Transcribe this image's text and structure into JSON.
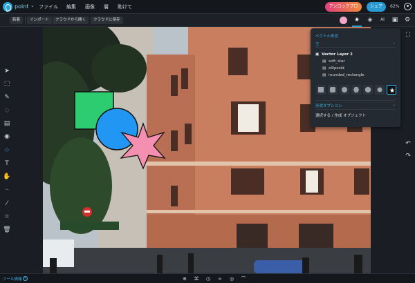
{
  "app": {
    "name": "point"
  },
  "menu": [
    "ファイル",
    "編集",
    "画像",
    "層",
    "助けて"
  ],
  "header": {
    "pro_label": "アンロックプロ",
    "share_label": "シェア",
    "zoom": "62%"
  },
  "toolbar": {
    "new_label": "新着",
    "import_label": "インポート",
    "open_cloud_label": "クラウドから開く",
    "save_cloud_label": "クラウドに保存",
    "fill_color": "#f2a6c8"
  },
  "panel": {
    "section_title": "ベクトル形状",
    "filter_value": "王",
    "group_name": "Vector Layer 2",
    "items": [
      "soft_star",
      "ellipsoid",
      "rounded_rectangle"
    ],
    "options_title": "形状オプション",
    "hint": "選択する / 作成 オブジェクト"
  },
  "bottom": {
    "tool_info": "ツール情報"
  },
  "shapes": {
    "green_fill": "#2ecc71",
    "blue_fill": "#2196f3",
    "pink_fill": "#f48fb1",
    "stroke": "#111111"
  },
  "colors": {
    "accent": "#2aa7e0",
    "panel_bg": "#242a31",
    "bar_bg": "#14171c"
  }
}
